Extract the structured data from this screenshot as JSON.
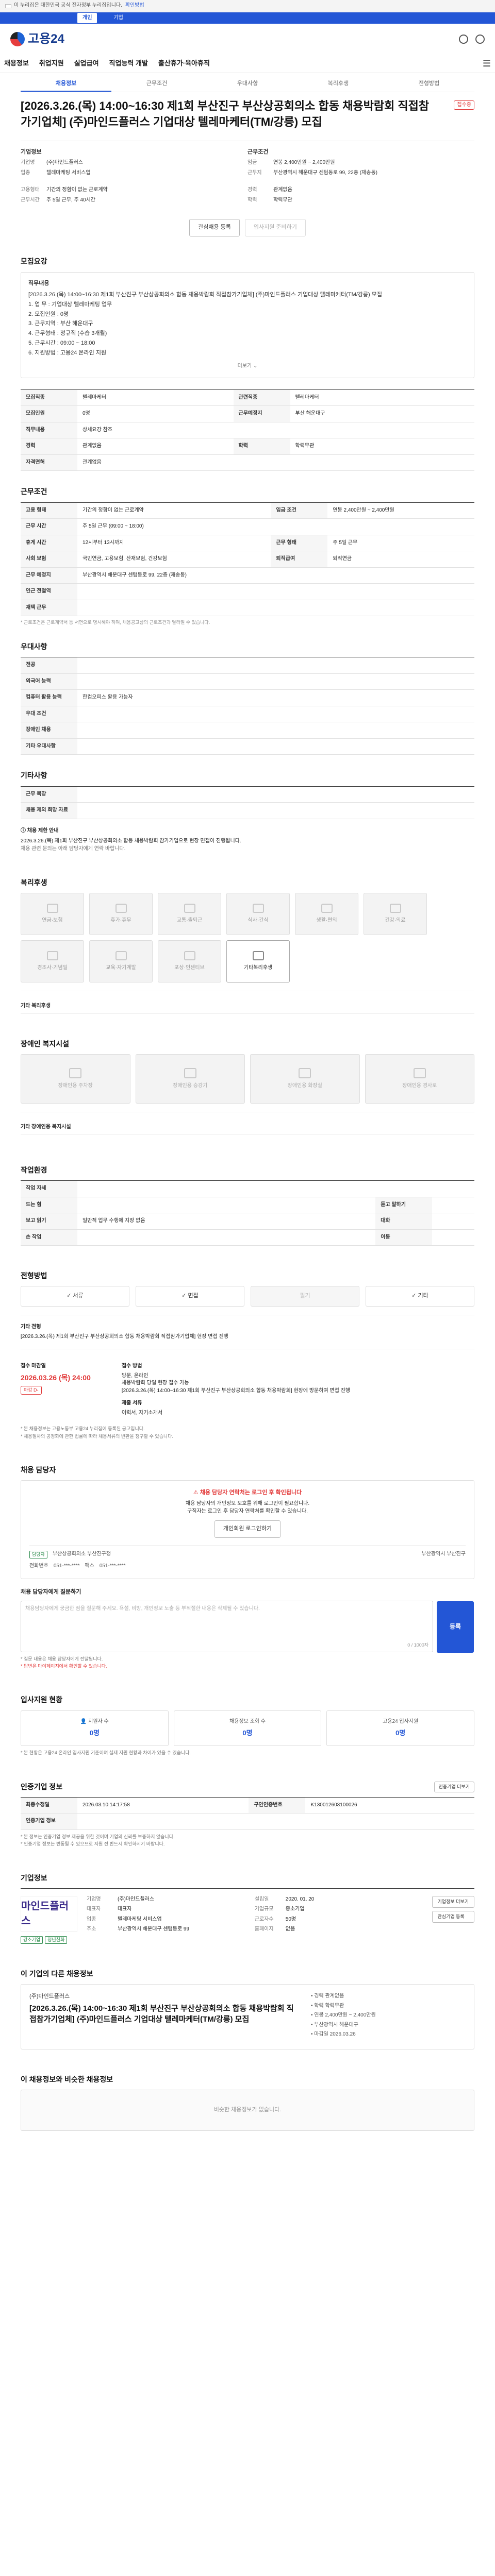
{
  "gov_bar": {
    "text": "이 누리집은 대한민국 공식 전자정부 누리집입니다.",
    "link": "확인방법"
  },
  "toolbar": {
    "items": [
      "개인",
      "기업"
    ]
  },
  "logo": {
    "text": "고용24"
  },
  "gnb": {
    "menus": [
      "채용정보",
      "취업지원",
      "실업급여",
      "직업능력 개발",
      "출산휴가·육아휴직"
    ]
  },
  "tabs": [
    "채용정보",
    "근무조건",
    "우대사항",
    "복리후생",
    "전형방법"
  ],
  "job": {
    "title": "[2026.3.26.(목) 14:00~16:30 제1회 부산진구 부산상공회의소 합동 채용박람회 직접참가기업체] (주)마인드플러스 기업대상 텔레마케터(TM/강릉) 모집",
    "status": "접수중",
    "company": {
      "heading": "기업정보",
      "name_k": "기업명",
      "name_v": "(주)마인드플러스",
      "biz_k": "업종",
      "biz_v": "텔레마케팅 서비스업",
      "size_k": "기업규모",
      "size_v": "기업규모",
      "pay_k": "근로자수",
      "pay_v": "근로자수 정보"
    },
    "conditions": {
      "heading": "근무조건",
      "salary_k": "임금",
      "salary_v": "연봉 2,400만원 ~ 2,400만원",
      "area_k": "근무지",
      "area_v": "부산광역시 해운대구 센텀동로 99, 22층 (재송동)",
      "emp_k": "고용형태",
      "emp_v": "기간의 정함이 없는 근로계약",
      "hours_k": "근무시간",
      "hours_v": "주 5일 근무, 주 40시간",
      "exp_k": "경력",
      "exp_v": "관계없음",
      "edu_k": "학력",
      "edu_v": "학력무관"
    },
    "buttons": {
      "scrap": "관심채용 등록",
      "share": "입사지원 준비하기"
    }
  },
  "sections": {
    "detail": "모집요강",
    "detail_inner_title": "직무내용",
    "detail_lines": [
      "[2026.3.26.(목) 14:00~16:30 제1회 부산진구 부산상공회의소 합동 채용박람회 직접참가기업체] (주)마인드플러스 기업대상 텔레마케터(TM/강릉) 모집",
      "1. 업 무 : 기업대상 텔레마케팅 업무",
      "2. 모집인원 : 0명",
      "3. 근무지역 : 부산 해운대구",
      "4. 근무형태 : 정규직 (수습 3개월)",
      "5. 근무시간 : 09:00 ~ 18:00",
      "6. 지원방법 : 고용24 온라인 지원"
    ],
    "more": "더보기",
    "table1": [
      {
        "k": "모집직종",
        "v": "텔레마케터",
        "k2": "관련직종",
        "v2": "텔레마케터"
      },
      {
        "k": "모집인원",
        "v": "0명",
        "k2": "근무예정지",
        "v2": "부산 해운대구"
      },
      {
        "k": "직무내용",
        "v": "상세요강 참조",
        "k2": "",
        "v2": ""
      },
      {
        "k": "경력",
        "v": "관계없음",
        "k2": "학력",
        "v2": "학력무관"
      },
      {
        "k": "자격면허",
        "v": "관계없음",
        "k2": "",
        "v2": ""
      }
    ],
    "table2": [
      {
        "k": "고용 형태",
        "v": "기간의 정함이 없는 근로계약",
        "k2": "임금 조건",
        "v2": "연봉 2,400만원 ~ 2,400만원"
      },
      {
        "k": "근무 시간",
        "v": "주 5일 근무 (09:00 ~ 18:00)",
        "k2": "",
        "v2": ""
      },
      {
        "k": "휴게 시간",
        "v": "12시부터 13시까지",
        "k2": "근무 형태",
        "v2": "주 5일 근무"
      },
      {
        "k": "사회 보험",
        "v": "국민연금, 고용보험, 산재보험, 건강보험",
        "k2": "퇴직급여",
        "v2": "퇴직연금"
      },
      {
        "k": "근무 예정지",
        "v": "부산광역시 해운대구 센텀동로 99, 22층 (재송동)",
        "k2": "",
        "v2": ""
      },
      {
        "k": "인근 전철역",
        "v": "",
        "k2": "",
        "v2": ""
      },
      {
        "k": "재택 근무",
        "v": "",
        "k2": "",
        "v2": ""
      }
    ],
    "table2_note": "* 근로조건은 근로계약서 등 서면으로 명시해야 하며, 채용공고상의 근로조건과 달라질 수 있습니다.",
    "pref": "우대사항",
    "pref_rows": [
      {
        "k": "전공",
        "v": ""
      },
      {
        "k": "외국어 능력",
        "v": ""
      },
      {
        "k": "컴퓨터 활용 능력",
        "v": "한컴오피스 활용 가능자"
      },
      {
        "k": "우대 조건",
        "v": ""
      },
      {
        "k": "장애인 채용",
        "v": ""
      },
      {
        "k": "기타 우대사항",
        "v": ""
      }
    ],
    "other": "기타사항",
    "other_rows": [
      {
        "k": "근무 복장",
        "v": ""
      },
      {
        "k": "채용 제외 희망 자료",
        "v": ""
      }
    ],
    "alert_title": "채용 제한 안내",
    "alert_lines": [
      "2026.3.26.(목) 제1회 부산진구 부산상공회의소 합동 채용박람회 참가기업으로 현장 면접이 진행됩니다.",
      "채용 관련 문의는 아래 담당자에게 연락 바랍니다."
    ],
    "welfare": "복리후생",
    "welfare_cards": [
      {
        "label": "연금·보험",
        "on": false
      },
      {
        "label": "휴가·휴무",
        "on": false
      },
      {
        "label": "교통·출퇴근",
        "on": false
      },
      {
        "label": "식사·간식",
        "on": false
      },
      {
        "label": "생활·편의",
        "on": false
      },
      {
        "label": "건강·의료",
        "on": false
      },
      {
        "label": "경조사·기념일",
        "on": false
      },
      {
        "label": "교육·자기계발",
        "on": false
      },
      {
        "label": "포상·인센티브",
        "on": false
      },
      {
        "label": "기타복리후생",
        "on": true
      }
    ],
    "welfare_extra_k": "기타 복리후생",
    "disabled": "장애인 복지시설",
    "disabled_cards": [
      "장애인용 주차장",
      "장애인용 승강기",
      "장애인용 화장실",
      "장애인용 경사로"
    ],
    "disabled_extra_k": "기타 장애인용 복지시설",
    "workplace": "작업환경",
    "workplace_rows": [
      {
        "k": "작업 자세",
        "v": "",
        "k2": "",
        "v2": ""
      },
      {
        "k": "드는 힘",
        "v": "",
        "k2": "듣고 말하기",
        "v2": ""
      },
      {
        "k": "보고 읽기",
        "v": "일반적 업무 수행에 지장 없음",
        "k2": "대화",
        "v2": ""
      },
      {
        "k": "손 작업",
        "v": "",
        "k2": "이동",
        "v2": ""
      }
    ],
    "selection": "전형방법",
    "steps": [
      {
        "label": "서류",
        "dim": false
      },
      {
        "label": "면접",
        "dim": false
      },
      {
        "label": "필기",
        "dim": true
      },
      {
        "label": "기타",
        "dim": false
      }
    ],
    "sel_extra_k": "기타 전형",
    "sel_extra_v": "[2026.3.26.(목) 제1회 부산진구 부산상공회의소 합동 채용박람회 직접참가기업체] 현장 면접 진행",
    "deadline_k": "접수 마감일",
    "deadline_v": "2026.03.26 (목) 24:00",
    "deadline_badge": "마감 D-",
    "method_k": "접수 방법",
    "method_lines": [
      "방문, 온라인",
      "채용박람회 당일 현장 접수 가능",
      "[2026.3.26.(목) 14:00~16:30 제1회 부산진구 부산상공회의소 합동 채용박람회] 현장에 방문하여 면접 진행"
    ],
    "docs_k": "제출 서류",
    "docs_v": "이력서, 자기소개서",
    "legal_lines": [
      "* 본 채용정보는 고용노동부 고용24 누리집에 등록된 공고입니다.",
      "* 채용절차의 공정화에 관한 법률에 따라 채용서류의 반환을 청구할 수 있습니다."
    ],
    "contact": "채용 담당자",
    "contact_warn": "채용 담당자 연락처는 로그인 후 확인됩니다",
    "contact_lines": [
      "채용 담당자의 개인정보 보호를 위해 로그인이 필요합니다.",
      "구직자는 로그인 후 담당자 연락처를 확인할 수 있습니다."
    ],
    "contact_btn": "개인회원 로그인하기",
    "manager_badge": "담당자",
    "manager_name": "부산상공회의소 부산진구청",
    "manager_phone_k": "전화번호",
    "manager_phone_v": "051-***-****",
    "manager_fax_k": "팩스",
    "manager_fax_v": "051-***-****",
    "manager_addr": "부산광역시 부산진구",
    "qa": "채용 담당자에게 질문하기",
    "qa_placeholder": "채용담당자에게 궁금한 점을 질문해 주세요. 욕설, 비방, 개인정보 노출 등 부적절한 내용은 삭제될 수 있습니다.",
    "qa_count": "0 / 1000자",
    "qa_btn": "등록",
    "qa_notes": [
      "* 질문 내용은 채용 담당자에게 전달됩니다.",
      "* 답변은 마이페이지에서 확인할 수 있습니다."
    ],
    "stats": "입사지원 현황",
    "stats_cards": [
      {
        "label": "지원자 수",
        "val": "0명"
      },
      {
        "label": "채용정보 조회 수",
        "val": "0명"
      },
      {
        "label": "고용24 입사지원",
        "val": "0명"
      }
    ],
    "stats_note": "* 본 현황은 고용24 온라인 입사지원 기준이며 실제 지원 현황과 차이가 있을 수 있습니다.",
    "auth": "인증기업 정보",
    "auth_btn": "인증기업 더보기",
    "auth_rows": [
      {
        "k": "최종수정일",
        "v": "2026.03.10 14:17:58",
        "k2": "구인인증번호",
        "v2": "K130012603100026"
      },
      {
        "k": "인증기업 정보",
        "v": "",
        "k2": "",
        "v2": ""
      }
    ],
    "auth_notes": [
      "* 본 정보는 인증기업 정보 제공을 위한 것이며 기업의 신뢰를 보증하지 않습니다.",
      "* 인증기업 정보는 변동될 수 있으므로 지원 전 반드시 확인하시기 바랍니다."
    ],
    "company_sec": "기업정보",
    "company_logo": "마인드플러스",
    "company_info": [
      {
        "k": "기업명",
        "v": "(주)마인드플러스"
      },
      {
        "k": "대표자",
        "v": "대표자"
      },
      {
        "k": "업종",
        "v": "텔레마케팅 서비스업"
      },
      {
        "k": "설립일",
        "v": "2020. 01. 20"
      },
      {
        "k": "기업규모",
        "v": "중소기업"
      },
      {
        "k": "근로자수",
        "v": "50명"
      },
      {
        "k": "주소",
        "v": "부산광역시 해운대구 센텀동로 99"
      },
      {
        "k": "홈페이지",
        "v": "없음"
      }
    ],
    "company_btns": [
      "기업정보 더보기",
      "관심기업 등록"
    ],
    "company_tags": [
      "강소기업",
      "청년친화"
    ],
    "similar": "이 기업의 다른 채용정보",
    "similar_company": "(주)마인드플러스",
    "similar_title": "[2026.3.26.(목) 14:00~16:30 제1회 부산진구 부산상공회의소 합동 채용박람회 직접참가기업체] (주)마인드플러스 기업대상 텔레마케터(TM/강릉) 모집",
    "similar_lines": [
      "• 경력 관계없음",
      "• 학력 학력무관",
      "• 연봉 2,400만원 ~ 2,400만원",
      "• 부산광역시 해운대구",
      "• 마감일 2026.03.26"
    ],
    "recommend": "이 채용정보와 비슷한 채용정보",
    "recommend_empty": "비슷한 채용정보가 없습니다."
  }
}
